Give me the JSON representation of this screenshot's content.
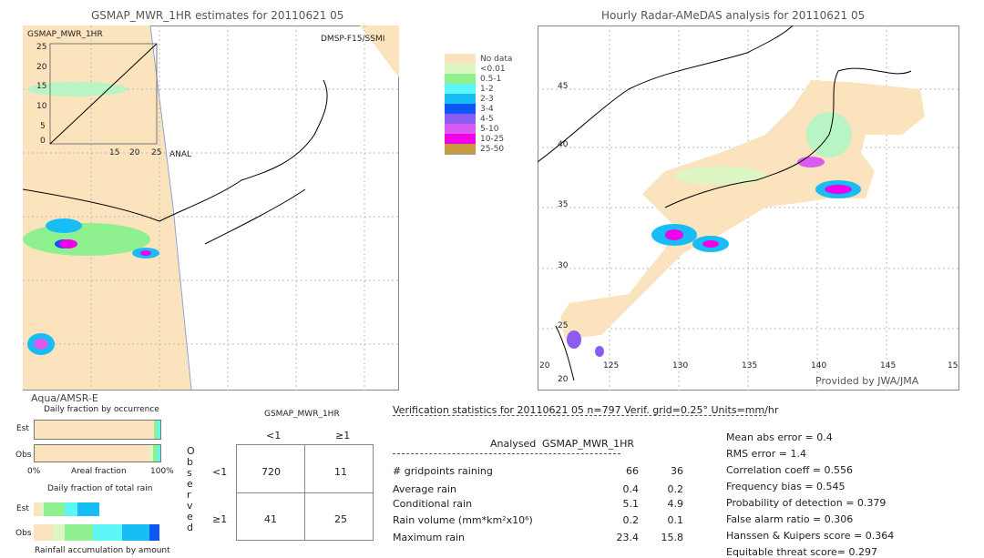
{
  "left_map": {
    "title": "GSMAP_MWR_1HR estimates for 20110621 05",
    "inset_label": "GSMAP_MWR_1HR",
    "sensor_top": "DMSP-F15/SSMI",
    "inset_xlabel": "ANAL",
    "inset_ticks": [
      "0",
      "5",
      "10",
      "15",
      "20",
      "25"
    ],
    "sensor_bottom": "Aqua/AMSR-E"
  },
  "right_map": {
    "title": "Hourly Radar-AMeDAS analysis for 20110621 05",
    "lat_ticks": [
      "45",
      "40",
      "35",
      "30",
      "25",
      "20"
    ],
    "lon_ticks": [
      "20",
      "125",
      "130",
      "135",
      "140",
      "145",
      "15"
    ],
    "credit": "Provided by JWA/JMA"
  },
  "legend": {
    "items": [
      {
        "label": "",
        "color": "#ffffff"
      },
      {
        "label": "No data",
        "color": "#fae3bd"
      },
      {
        "label": "<0.01",
        "color": "#dcf7c4"
      },
      {
        "label": "0.5-1",
        "color": "#8ef08e"
      },
      {
        "label": "1-2",
        "color": "#5cf6f6"
      },
      {
        "label": "2-3",
        "color": "#18bdf5"
      },
      {
        "label": "3-4",
        "color": "#0a57f5"
      },
      {
        "label": "4-5",
        "color": "#8a5cf2"
      },
      {
        "label": "5-10",
        "color": "#d85cf2"
      },
      {
        "label": "10-25",
        "color": "#f000e8"
      },
      {
        "label": "25-50",
        "color": "#c89a40"
      }
    ]
  },
  "fraction": {
    "occurrence_title": "Daily fraction by occurrence",
    "est": "Est",
    "obs": "Obs",
    "x_start": "0%",
    "x_label": "Areal fraction",
    "x_end": "100%",
    "total_title": "Daily fraction of total rain",
    "accum_label": "Rainfall accumulation by amount",
    "occ_est": [
      {
        "pct": 95,
        "color": "#fae3bd"
      },
      {
        "pct": 3,
        "color": "#8ef08e"
      },
      {
        "pct": 2,
        "color": "#5cf6f6"
      }
    ],
    "occ_obs": [
      {
        "pct": 91,
        "color": "#fae3bd"
      },
      {
        "pct": 3,
        "color": "#dcf7c4"
      },
      {
        "pct": 4,
        "color": "#8ef08e"
      },
      {
        "pct": 2,
        "color": "#5cf6f6"
      }
    ],
    "rain_est": [
      {
        "pct": 5,
        "color": "#fae3bd"
      },
      {
        "pct": 3,
        "color": "#dcf7c4"
      },
      {
        "pct": 17,
        "color": "#8ef08e"
      },
      {
        "pct": 10,
        "color": "#5cf6f6"
      },
      {
        "pct": 17,
        "color": "#18bdf5"
      }
    ],
    "rain_obs": [
      {
        "pct": 15,
        "color": "#fae3bd"
      },
      {
        "pct": 10,
        "color": "#dcf7c4"
      },
      {
        "pct": 22,
        "color": "#8ef08e"
      },
      {
        "pct": 23,
        "color": "#5cf6f6"
      },
      {
        "pct": 22,
        "color": "#18bdf5"
      },
      {
        "pct": 8,
        "color": "#0a57f5"
      }
    ]
  },
  "contingency": {
    "title": "GSMAP_MWR_1HR",
    "col_lt": "<1",
    "col_ge": "≥1",
    "row_lt": "<1",
    "row_ge": "≥1",
    "observed": [
      "O",
      "b",
      "s",
      "e",
      "r",
      "v",
      "e",
      "d"
    ],
    "cells": {
      "a": "720",
      "b": "11",
      "c": "41",
      "d": "25"
    }
  },
  "stats": {
    "title": "Verification statistics for 20110621 05   n=797   Verif. grid=0.25°   Units=mm/hr",
    "col_analysed": "Analysed",
    "col_est": "GSMAP_MWR_1HR",
    "rows": [
      {
        "label": "# gridpoints raining",
        "a": "66",
        "e": "36"
      },
      {
        "label": "Average rain",
        "a": "0.4",
        "e": "0.2"
      },
      {
        "label": "Conditional rain",
        "a": "5.1",
        "e": "4.9"
      },
      {
        "label": "Rain volume (mm*km²x10⁶)",
        "a": "0.2",
        "e": "0.1"
      },
      {
        "label": "Maximum rain",
        "a": "23.4",
        "e": "15.8"
      }
    ],
    "scores": [
      "Mean abs error = 0.4",
      "RMS error = 1.4",
      "Correlation coeff = 0.556",
      "Frequency bias = 0.545",
      "Probability of detection = 0.379",
      "False alarm ratio = 0.306",
      "Hanssen & Kuipers score = 0.364",
      "Equitable threat score= 0.297"
    ]
  }
}
